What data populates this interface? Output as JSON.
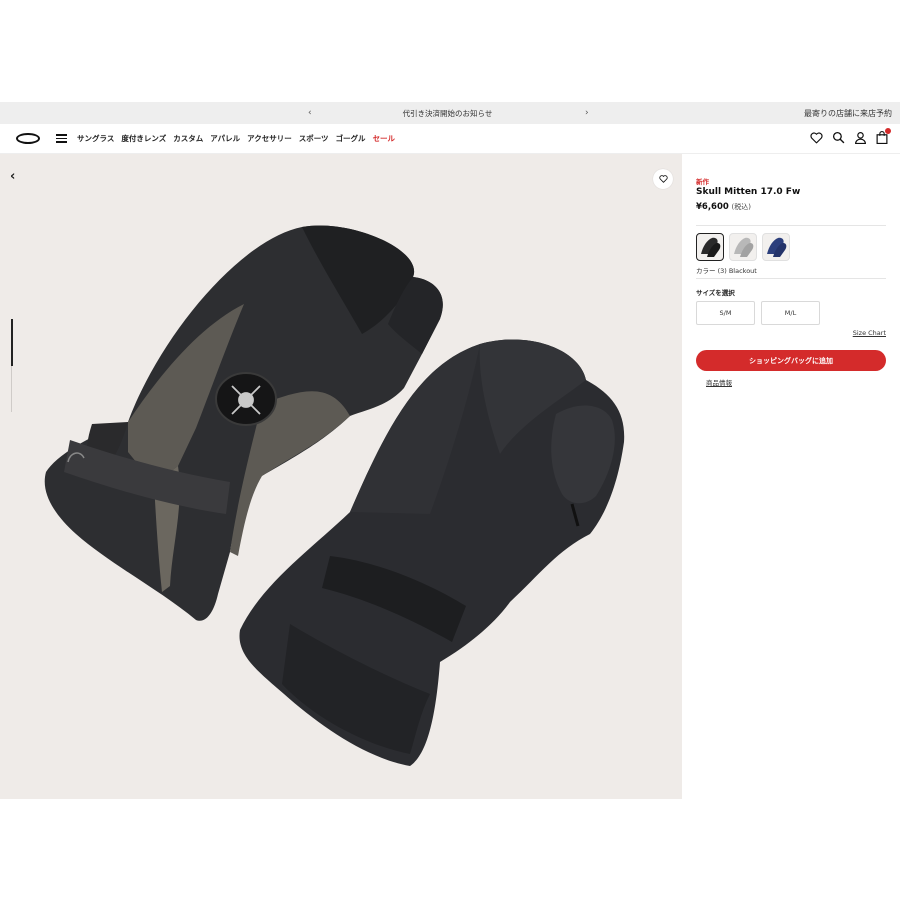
{
  "announcement": {
    "prev_arrow": "‹",
    "next_arrow": "›",
    "message": "代引き決済開始のお知らせ",
    "store_link": "最寄りの店舗に来店予約"
  },
  "nav": {
    "menu": [
      "サングラス",
      "度付きレンズ",
      "カスタム",
      "アパレル",
      "アクセサリー",
      "スポーツ",
      "ゴーグル"
    ],
    "sale": "セール"
  },
  "gallery": {
    "back_arrow": "‹",
    "image_index": 1,
    "image_count": 2
  },
  "product": {
    "badge": "新作",
    "name": "Skull Mitten 17.0 Fw",
    "price": "¥6,600",
    "tax_note": "(税込)",
    "color_label": "カラー (3) Blackout",
    "size_title": "サイズを選択",
    "sizes": [
      "S/M",
      "M/L"
    ],
    "size_chart": "Size Chart",
    "add_to_bag": "ショッピングバッグに追加",
    "product_info": "商品情報"
  },
  "colors": {
    "accent": "#d42b2b",
    "swatches": [
      "#2a2a2a",
      "#b8b8b8",
      "#2c3f7c"
    ]
  }
}
